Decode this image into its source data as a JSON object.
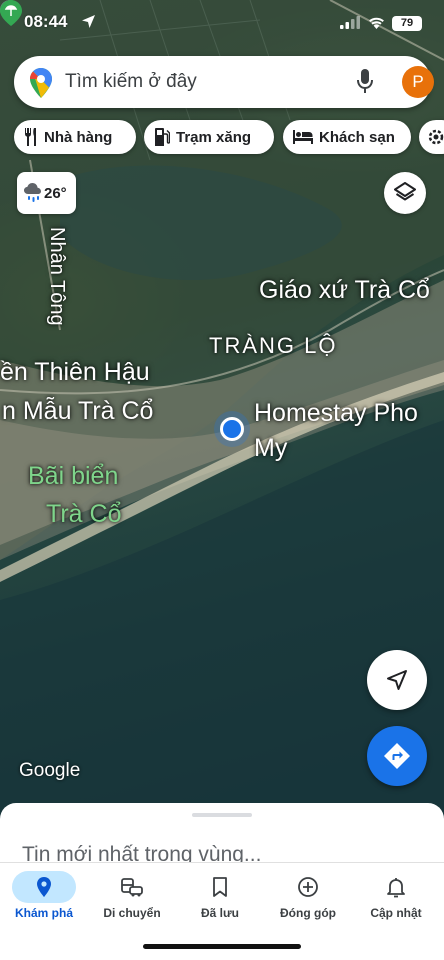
{
  "status_bar": {
    "time": "08:44",
    "battery": "79"
  },
  "search": {
    "placeholder": "Tìm kiếm ở đây",
    "avatar_letter": "P"
  },
  "chips": [
    {
      "label": "Nhà hàng",
      "icon": "restaurant-icon"
    },
    {
      "label": "Trạm xăng",
      "icon": "gas-station-icon"
    },
    {
      "label": "Khách sạn",
      "icon": "hotel-icon"
    }
  ],
  "weather": {
    "temperature": "26°",
    "icon": "rain-cloud-icon"
  },
  "map_labels": {
    "road": "Nhân Tông",
    "church": "Giáo xứ Trà Cổ",
    "village": "TRÀNG LỘ",
    "temple_line1": "ền Thiên Hậu",
    "temple_line2": "n Mẫu Trà Cổ",
    "beach_line1": "Bãi biển",
    "beach_line2": "Trà Cổ",
    "homestay_line1": "Homestay Pho",
    "homestay_line2": "My"
  },
  "google_logo": "Google",
  "sheet": {
    "teaser": "Tin mới nhất trong vùng..."
  },
  "nav": [
    {
      "label": "Khám phá",
      "icon": "explore-pin-icon",
      "active": true
    },
    {
      "label": "Di chuyển",
      "icon": "commute-icon",
      "active": false
    },
    {
      "label": "Đã lưu",
      "icon": "bookmark-icon",
      "active": false
    },
    {
      "label": "Đóng góp",
      "icon": "add-circle-icon",
      "active": false
    },
    {
      "label": "Cập nhật",
      "icon": "bell-icon",
      "active": false
    }
  ],
  "colors": {
    "accent": "#1a73e8",
    "active_nav_bg": "#c2e7ff",
    "avatar": "#e8710a",
    "poi_green": "#34a853"
  }
}
